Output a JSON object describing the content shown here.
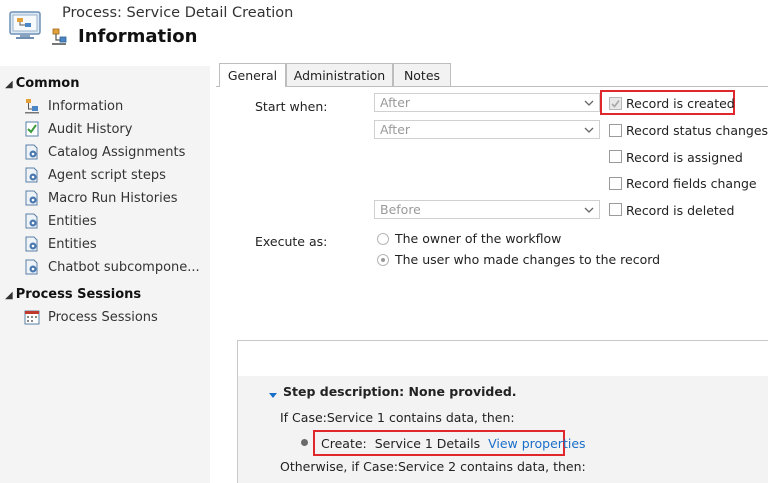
{
  "header": {
    "process_title": "Process: Service Detail Creation",
    "page_title": "Information"
  },
  "nav": {
    "sections": [
      {
        "label": "Common",
        "items": [
          {
            "label": "Information",
            "icon": "information-form-icon"
          },
          {
            "label": "Audit History",
            "icon": "audit-history-icon"
          },
          {
            "label": "Catalog Assignments",
            "icon": "related-entity-icon"
          },
          {
            "label": "Agent script steps",
            "icon": "related-entity-icon"
          },
          {
            "label": "Macro Run Histories",
            "icon": "related-entity-icon"
          },
          {
            "label": "Entities",
            "icon": "related-entity-icon"
          },
          {
            "label": "Entities",
            "icon": "related-entity-icon"
          },
          {
            "label": "Chatbot subcompone...",
            "icon": "related-entity-icon"
          }
        ]
      },
      {
        "label": "Process Sessions",
        "items": [
          {
            "label": "Process Sessions",
            "icon": "calendar-icon"
          }
        ]
      }
    ]
  },
  "tabs": [
    {
      "label": "General",
      "active": true
    },
    {
      "label": "Administration",
      "active": false
    },
    {
      "label": "Notes",
      "active": false
    }
  ],
  "form": {
    "start_when_label": "Start when:",
    "select1": "After",
    "select2": "After",
    "select3": "Before",
    "checkboxes": [
      {
        "label": "Record is created",
        "checked": true,
        "disabled": true
      },
      {
        "label": "Record status changes",
        "checked": false
      },
      {
        "label": "Record is assigned",
        "checked": false
      },
      {
        "label": "Record fields change",
        "checked": false
      },
      {
        "label": "Record is deleted",
        "checked": false
      }
    ],
    "execute_as_label": "Execute as:",
    "radios": [
      {
        "label": "The owner of the workflow",
        "selected": false
      },
      {
        "label": "The user who made changes to the record",
        "selected": true
      }
    ]
  },
  "steps": {
    "description": "Step description: None provided.",
    "line1": "If Case:Service 1 contains data, then:",
    "create_prefix": "Create:",
    "create_entity": "Service 1 Details",
    "create_link": "View properties",
    "line2": "Otherwise, if Case:Service 2 contains data, then:"
  },
  "colors": {
    "highlight": "#e0282c",
    "link": "#1a6fc9",
    "nav_background": "#f4f4f4"
  }
}
